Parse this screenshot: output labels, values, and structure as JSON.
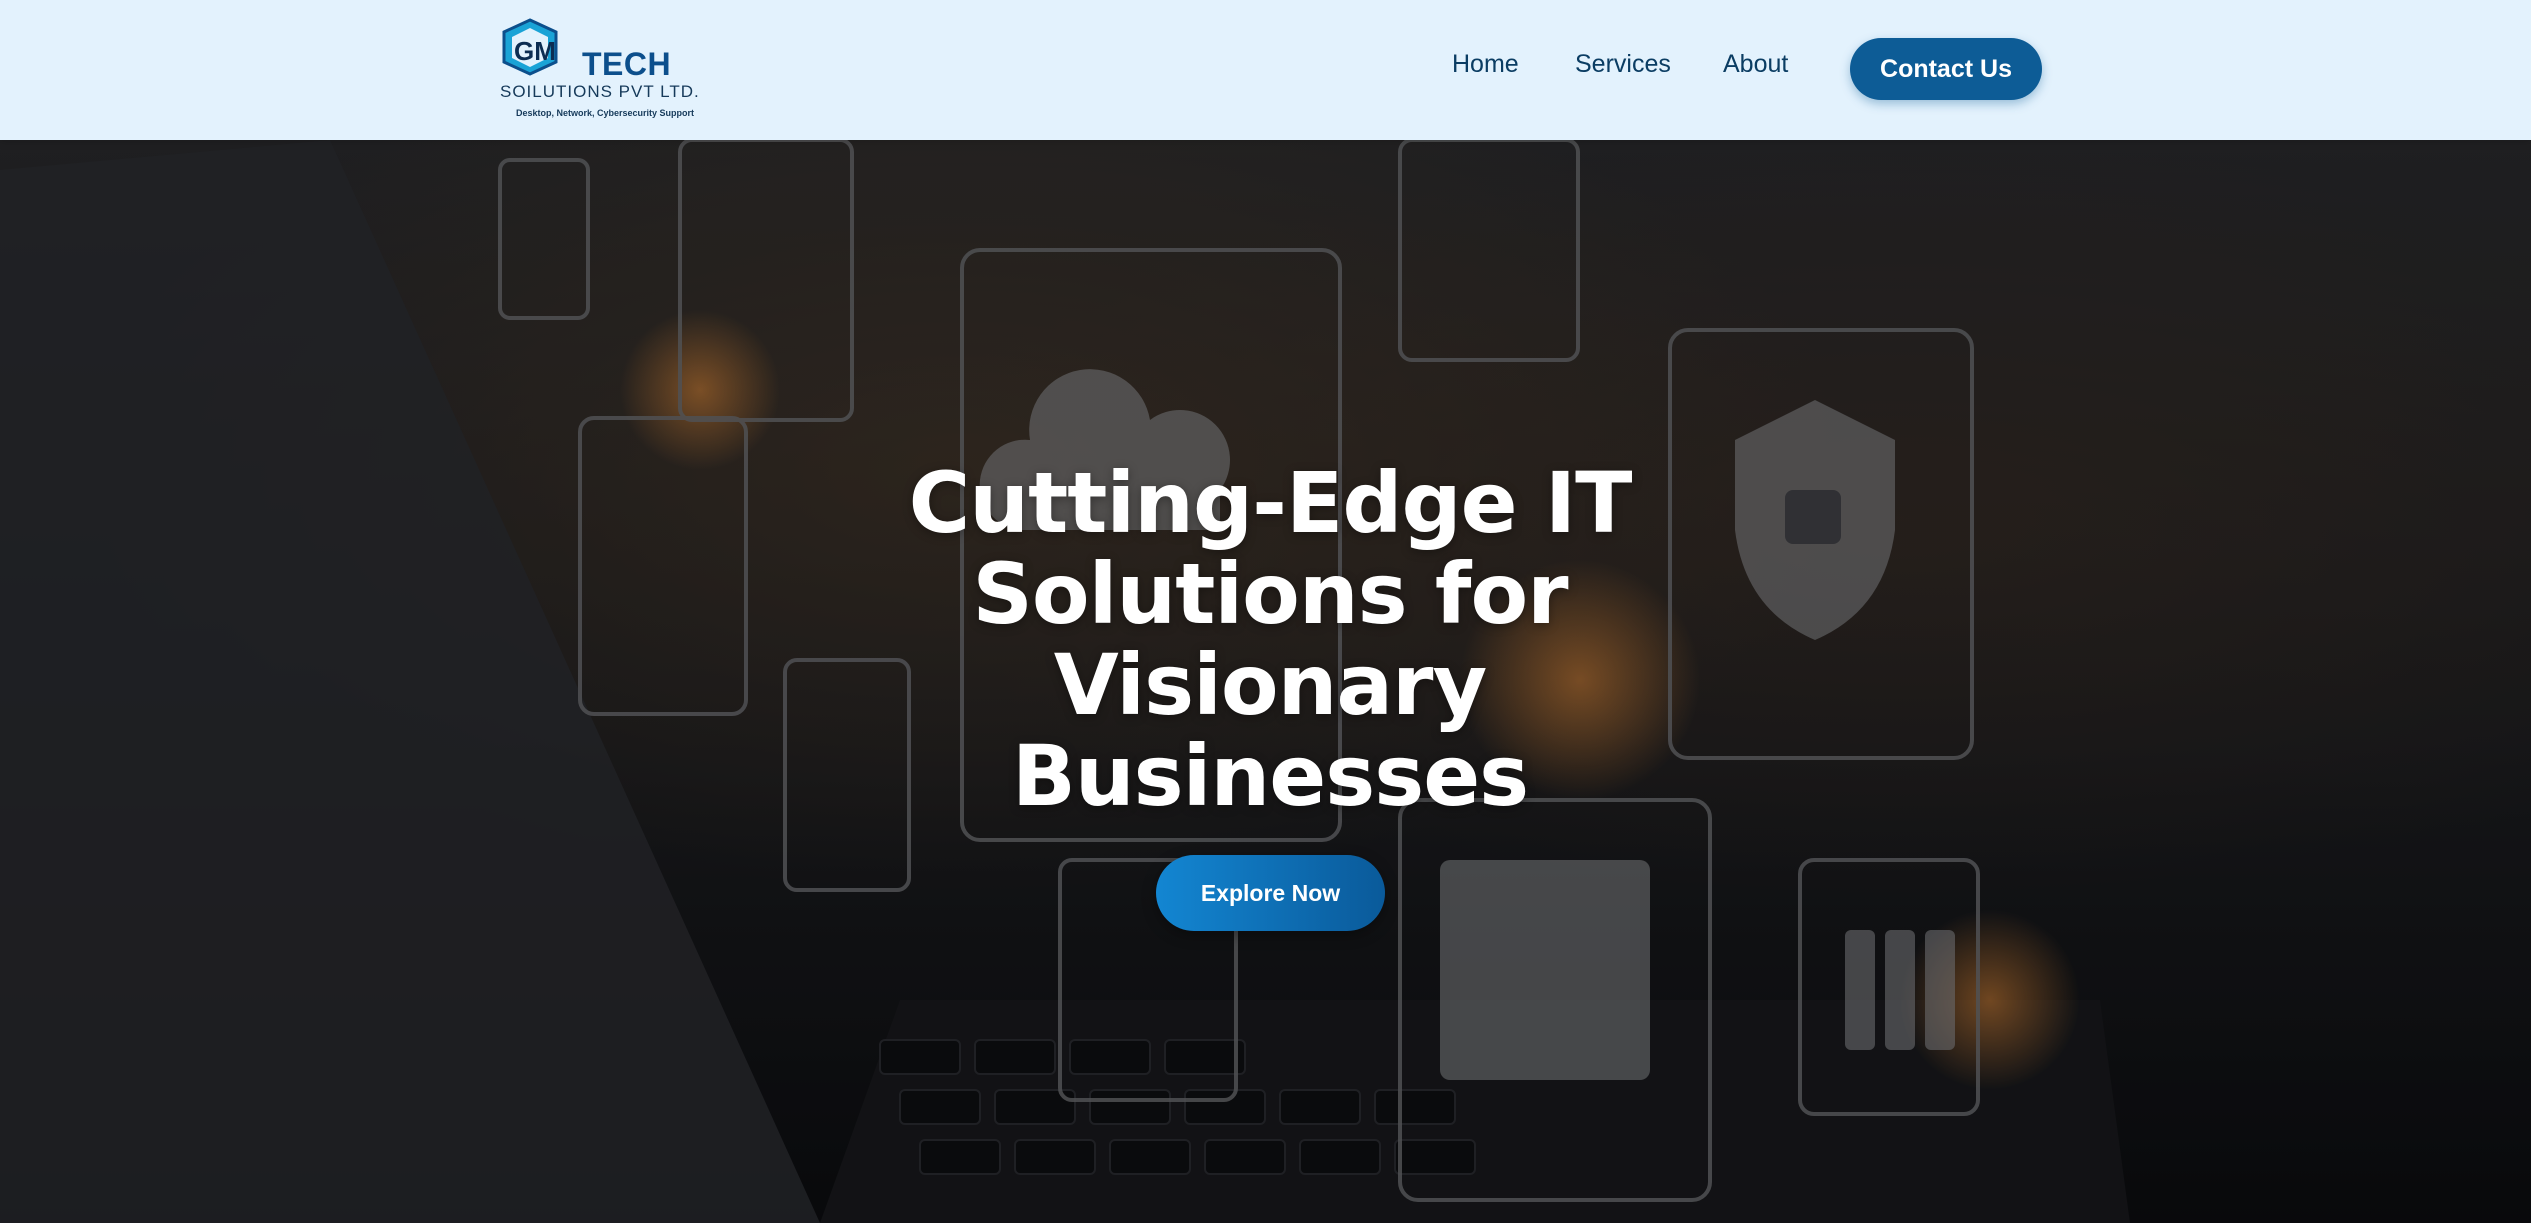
{
  "header": {
    "logo": {
      "mark_letters": "GM",
      "tech": "TECH",
      "company": "SOILUTIONS PVT LTD.",
      "tagline": "Desktop, Network, Cybersecurity Support"
    },
    "nav": {
      "home": "Home",
      "services": "Services",
      "about": "About"
    },
    "contact_label": "Contact Us"
  },
  "hero": {
    "title_line1": "Cutting-Edge IT",
    "title_line2": "Solutions for",
    "title_line3": "Visionary",
    "title_line4": "Businesses",
    "cta_label": "Explore Now",
    "background_icons": [
      "gears-icon",
      "document-icon",
      "server-icon",
      "cloud-upload-icon",
      "cloud-sync-icon",
      "shield-lock-icon",
      "user-icon",
      "image-icon",
      "folder-icon",
      "mobile-devices-icon"
    ]
  },
  "colors": {
    "header_bg": "#e3f2fd",
    "nav_text": "#0b3d63",
    "contact_bg": "#0d5c96",
    "cta_start": "#1386d2",
    "cta_end": "#0a5a9a"
  }
}
